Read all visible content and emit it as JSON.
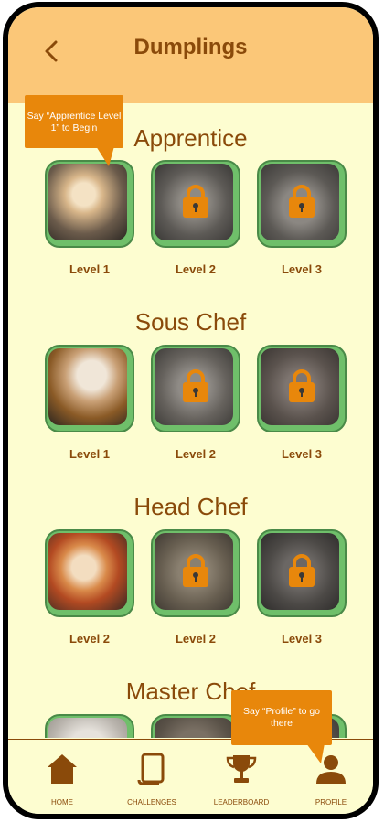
{
  "header": {
    "title": "Dumplings",
    "back_icon": "chevron-left-icon"
  },
  "tooltips": {
    "apprentice": "Say “Apprentice Level 1” to Begin",
    "profile": "Say “Profile” to go there"
  },
  "sections": [
    {
      "title": "Apprentice",
      "levels": [
        {
          "label": "Level 1",
          "locked": false
        },
        {
          "label": "Level 2",
          "locked": true
        },
        {
          "label": "Level 3",
          "locked": true
        }
      ]
    },
    {
      "title": "Sous Chef",
      "levels": [
        {
          "label": "Level 1",
          "locked": false
        },
        {
          "label": "Level 2",
          "locked": true
        },
        {
          "label": "Level 3",
          "locked": true
        }
      ]
    },
    {
      "title": "Head Chef",
      "levels": [
        {
          "label": "Level 2",
          "locked": false
        },
        {
          "label": "Level 2",
          "locked": true
        },
        {
          "label": "Level 3",
          "locked": true
        }
      ]
    },
    {
      "title": "Master Chef",
      "levels": []
    }
  ],
  "tabbar": [
    {
      "label": "HOME",
      "icon": "home-icon"
    },
    {
      "label": "CHALLENGES",
      "icon": "challenges-icon"
    },
    {
      "label": "LEADERBOARD",
      "icon": "trophy-icon"
    },
    {
      "label": "PROFILE",
      "icon": "profile-icon"
    }
  ],
  "colors": {
    "header": "#fbc778",
    "background": "#fdfdd0",
    "accent": "#e8870b",
    "text": "#8a4a0a",
    "tile": "#6fbf6a"
  }
}
